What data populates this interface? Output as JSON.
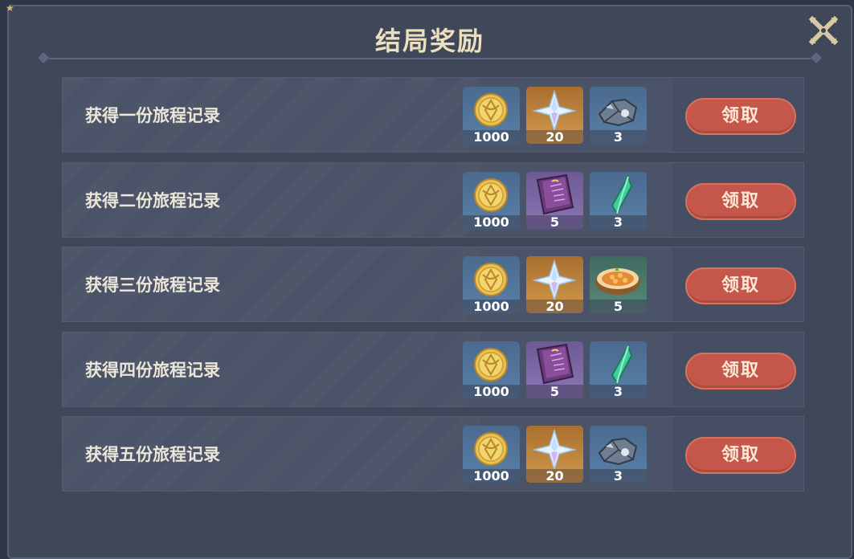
{
  "dialog": {
    "title": "结局奖励",
    "claim_label": "领取"
  },
  "rows": [
    {
      "label": "获得一份旅程记录",
      "items": [
        {
          "icon": "mora-coin-icon",
          "qty": "1000",
          "bg": "blue"
        },
        {
          "icon": "primogem-icon",
          "qty": "20",
          "bg": "gold"
        },
        {
          "icon": "ore-icon",
          "qty": "3",
          "bg": "blue"
        }
      ]
    },
    {
      "label": "获得二份旅程记录",
      "items": [
        {
          "icon": "mora-coin-icon",
          "qty": "1000",
          "bg": "blue"
        },
        {
          "icon": "exp-book-icon",
          "qty": "5",
          "bg": "purple"
        },
        {
          "icon": "crystal-icon",
          "qty": "3",
          "bg": "blue"
        }
      ]
    },
    {
      "label": "获得三份旅程记录",
      "items": [
        {
          "icon": "mora-coin-icon",
          "qty": "1000",
          "bg": "blue"
        },
        {
          "icon": "primogem-icon",
          "qty": "20",
          "bg": "gold"
        },
        {
          "icon": "food-dish-icon",
          "qty": "5",
          "bg": "green"
        }
      ]
    },
    {
      "label": "获得四份旅程记录",
      "items": [
        {
          "icon": "mora-coin-icon",
          "qty": "1000",
          "bg": "blue"
        },
        {
          "icon": "exp-book-icon",
          "qty": "5",
          "bg": "purple"
        },
        {
          "icon": "crystal-icon",
          "qty": "3",
          "bg": "blue"
        }
      ]
    },
    {
      "label": "获得五份旅程记录",
      "items": [
        {
          "icon": "mora-coin-icon",
          "qty": "1000",
          "bg": "blue"
        },
        {
          "icon": "primogem-icon",
          "qty": "20",
          "bg": "gold"
        },
        {
          "icon": "ore-icon",
          "qty": "3",
          "bg": "blue"
        }
      ]
    }
  ],
  "colors": {
    "title": "#ecdfbf",
    "claim_button": "#c4574a",
    "panel": "#3f4759"
  }
}
